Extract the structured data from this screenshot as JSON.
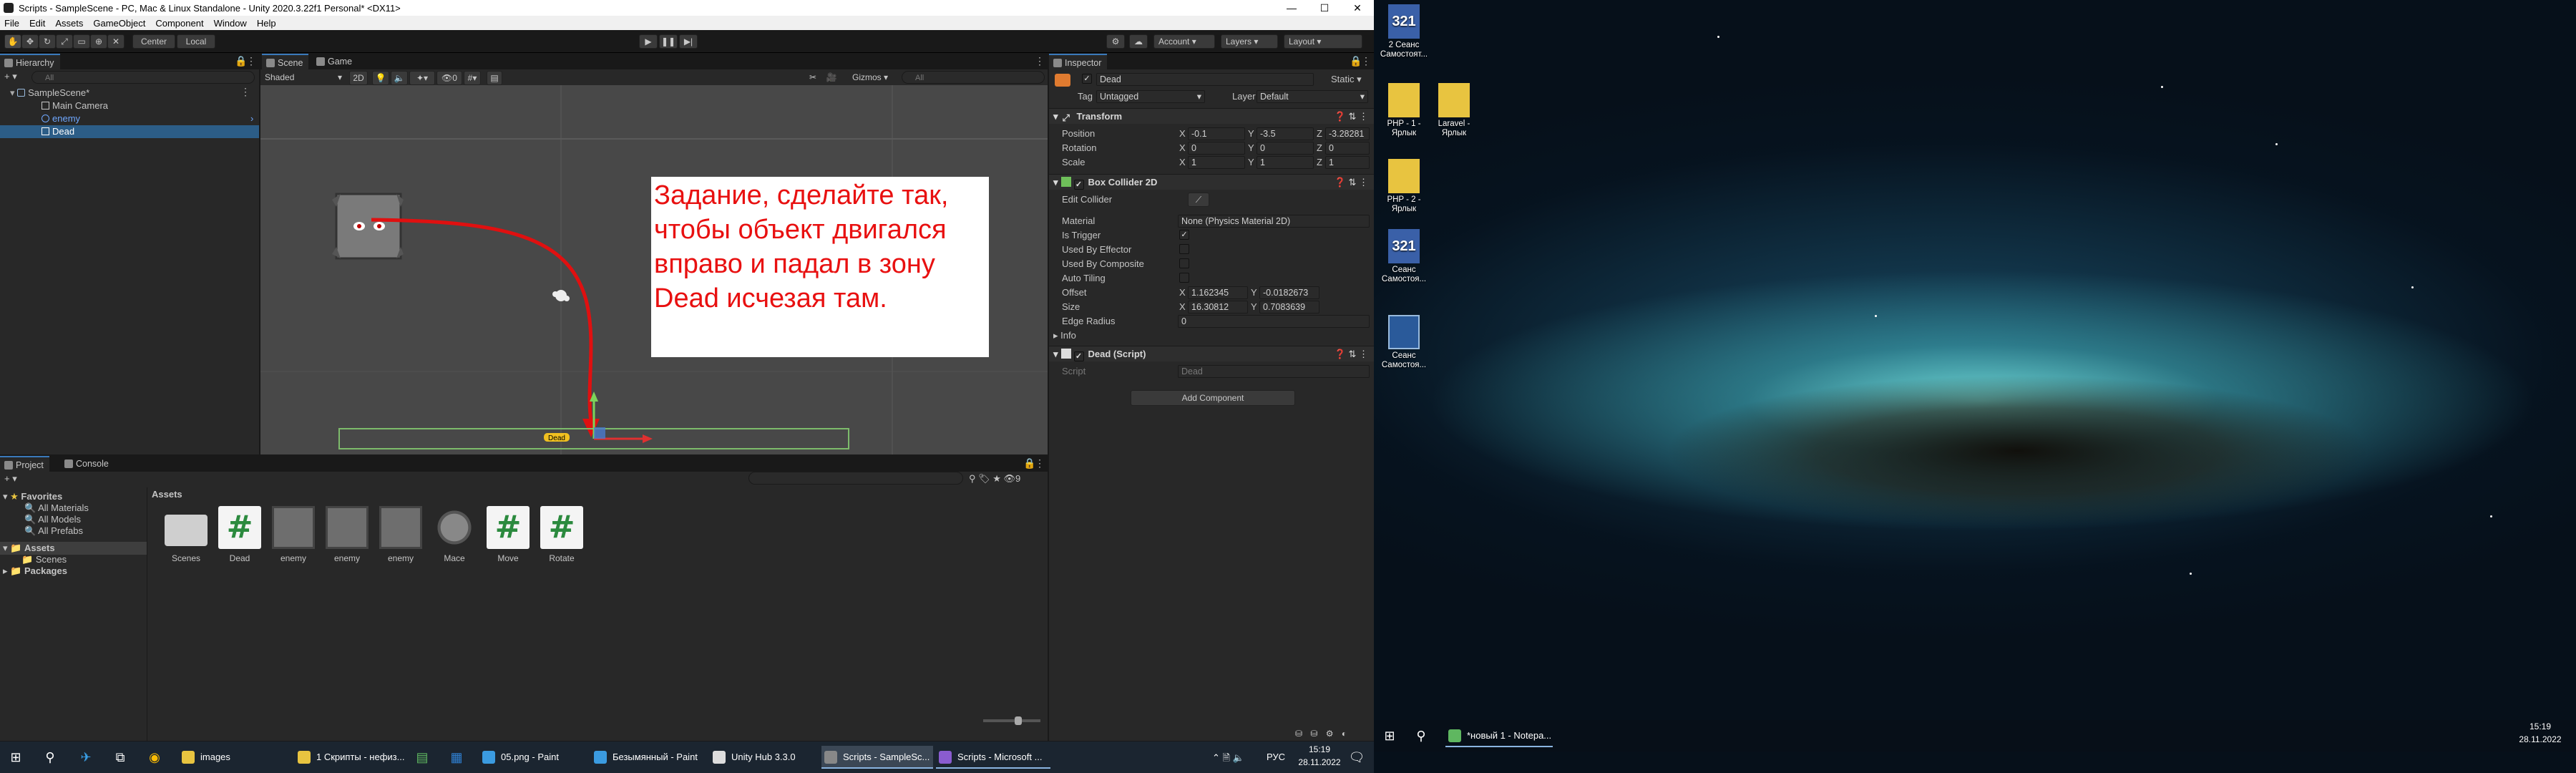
{
  "window": {
    "title": "Scripts - SampleScene - PC, Mac & Linux Standalone - Unity 2020.3.22f1 Personal* <DX11>",
    "minimize": "—",
    "maximize": "☐",
    "close": "✕"
  },
  "menu": [
    "File",
    "Edit",
    "Assets",
    "GameObject",
    "Component",
    "Window",
    "Help"
  ],
  "toolbar": {
    "center": "Center",
    "local": "Local",
    "account": "Account",
    "layers": "Layers",
    "layout": "Layout"
  },
  "hierarchy": {
    "tab": "Hierarchy",
    "search_placeholder": "All",
    "scene": "SampleScene*",
    "items": [
      "Main Camera",
      "enemy",
      "Dead"
    ]
  },
  "scene": {
    "tab_scene": "Scene",
    "tab_game": "Game",
    "shading": "Shaded",
    "mode2d": "2D",
    "gizmos": "Gizmos",
    "search_placeholder": "All",
    "dead_label": "Dead",
    "note": "Задание, сделайте так, чтобы объект двигался вправо и падал в зону Dead исчезая там."
  },
  "inspector": {
    "tab": "Inspector",
    "object_name": "Dead",
    "static": "Static",
    "tag_label": "Tag",
    "tag": "Untagged",
    "layer_label": "Layer",
    "layer": "Default",
    "transform": {
      "title": "Transform",
      "position_label": "Position",
      "rotation_label": "Rotation",
      "scale_label": "Scale",
      "position": [
        "-0.1",
        "-3.5",
        "-3.28281"
      ],
      "rotation": [
        "0",
        "0",
        "0"
      ],
      "scale": [
        "1",
        "1",
        "1"
      ]
    },
    "collider": {
      "title": "Box Collider 2D",
      "edit_collider": "Edit Collider",
      "material_label": "Material",
      "material": "None (Physics Material 2D)",
      "is_trigger": "Is Trigger",
      "used_by_effector": "Used By Effector",
      "used_by_composite": "Used By Composite",
      "auto_tiling": "Auto Tiling",
      "offset_label": "Offset",
      "offset": [
        "1.162345",
        "-0.0182673"
      ],
      "size_label": "Size",
      "size": [
        "16.30812",
        "0.7083639"
      ],
      "edge_radius_label": "Edge Radius",
      "edge_radius": "0",
      "info": "Info"
    },
    "script": {
      "title": "Dead (Script)",
      "script_label": "Script",
      "script_value": "Dead"
    },
    "add_component": "Add Component"
  },
  "project": {
    "tab_project": "Project",
    "tab_console": "Console",
    "count": "9",
    "tree": {
      "favorites": "Favorites",
      "fav_items": [
        "All Materials",
        "All Models",
        "All Prefabs"
      ],
      "assets": "Assets",
      "scenes": "Scenes",
      "packages": "Packages"
    },
    "breadcrumb": "Assets",
    "assets": [
      {
        "name": "Scenes",
        "kind": "folder"
      },
      {
        "name": "Dead",
        "kind": "script"
      },
      {
        "name": "enemy",
        "kind": "enemy"
      },
      {
        "name": "enemy",
        "kind": "enemy"
      },
      {
        "name": "enemy",
        "kind": "enemy"
      },
      {
        "name": "Mace",
        "kind": "mace"
      },
      {
        "name": "Move",
        "kind": "script"
      },
      {
        "name": "Rotate",
        "kind": "script"
      }
    ]
  },
  "taskbar_left": {
    "items": [
      "images",
      "1 Скрипты - нефиз...",
      "05.png - Paint",
      "Безымянный - Paint",
      "Unity Hub 3.3.0",
      "Scripts - SampleSc...",
      "Scripts - Microsoft ..."
    ],
    "lang": "РУС",
    "time": "15:19",
    "date": "28.11.2022"
  },
  "desktop": {
    "icons": [
      "2 Сеанс Самостоят...",
      "PHP - 1 - Ярлык",
      "Laravel - Ярлык",
      "PHP - 2 - Ярлык",
      "Сеанс Самостоя...",
      "Сеанс Самостоя..."
    ],
    "taskbar": {
      "item": "*новый 1 - Notepa...",
      "time": "15:19",
      "date": "28.11.2022"
    }
  }
}
